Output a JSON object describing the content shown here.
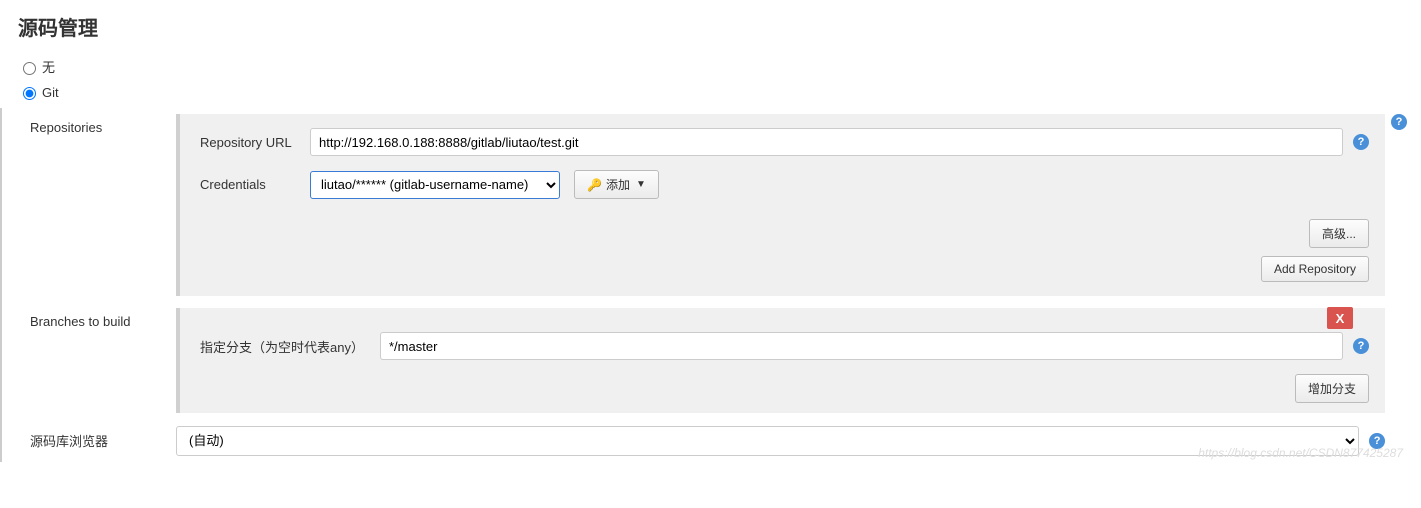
{
  "section_title": "源码管理",
  "scm_options": {
    "none": "无",
    "git": "Git"
  },
  "repositories": {
    "label": "Repositories",
    "url_label": "Repository URL",
    "url_value": "http://192.168.0.188:8888/gitlab/liutao/test.git",
    "cred_label": "Credentials",
    "cred_selected": "liutao/****** (gitlab-username-name)",
    "add_cred_btn": "添加",
    "advanced_btn": "高级...",
    "add_repo_btn": "Add Repository"
  },
  "branches": {
    "label": "Branches to build",
    "branch_spec_label": "指定分支（为空时代表any）",
    "branch_value": "*/master",
    "add_branch_btn": "增加分支",
    "delete_x": "X"
  },
  "browser": {
    "label": "源码库浏览器",
    "selected": "(自动)"
  },
  "help_glyph": "?",
  "key_icon": "🔑",
  "caret": "▼",
  "watermark": "https://blog.csdn.net/CSDN877425287"
}
